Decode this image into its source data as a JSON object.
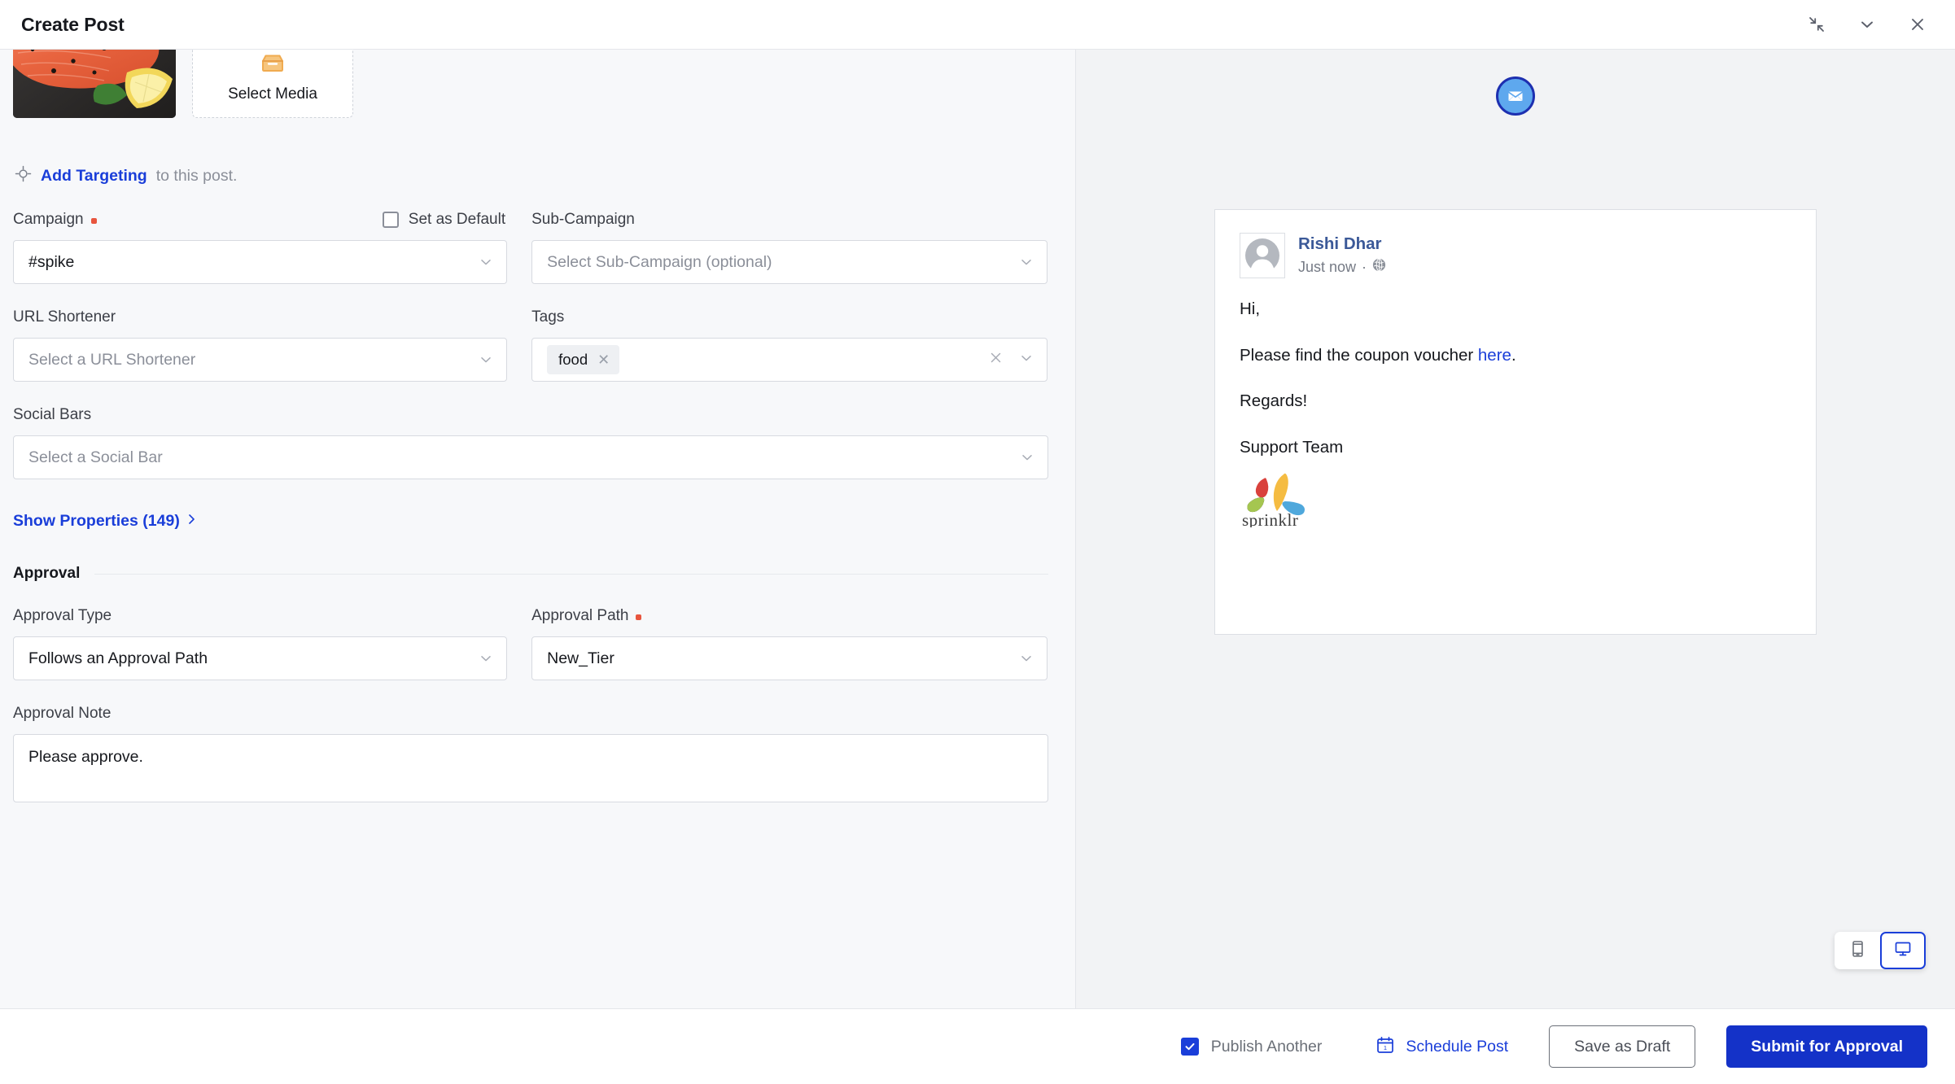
{
  "window": {
    "title": "Create Post",
    "actions": [
      {
        "name": "collapse-icon",
        "label": "Collapse"
      },
      {
        "name": "chevron-down-icon",
        "label": "Minimize"
      },
      {
        "name": "close-icon",
        "label": "Close"
      }
    ]
  },
  "media": {
    "thumbnail_alt": "Raw salmon fillet with rosemary, peppercorns and lemon on slate",
    "select_media_label": "Select Media",
    "select_media_icon": "inbox-icon"
  },
  "targeting": {
    "icon": "target-icon",
    "link_label": "Add Targeting",
    "suffix_text": "to this post."
  },
  "fields": {
    "campaign": {
      "label": "Campaign",
      "required": true,
      "value": "#spike",
      "set_as_default_label": "Set as Default",
      "set_as_default_checked": false
    },
    "sub_campaign": {
      "label": "Sub-Campaign",
      "required": false,
      "placeholder": "Select Sub-Campaign (optional)"
    },
    "url_shortener": {
      "label": "URL Shortener",
      "required": false,
      "placeholder": "Select a URL Shortener"
    },
    "tags": {
      "label": "Tags",
      "required": false,
      "chips": [
        "food"
      ]
    },
    "social_bars": {
      "label": "Social Bars",
      "required": false,
      "placeholder": "Select a Social Bar"
    }
  },
  "show_properties": {
    "label": "Show Properties (149)",
    "chevron": "›"
  },
  "approval": {
    "section_title": "Approval",
    "type": {
      "label": "Approval Type",
      "required": false,
      "value": "Follows an Approval Path"
    },
    "path": {
      "label": "Approval Path",
      "required": true,
      "value": "New_Tier"
    },
    "note": {
      "label": "Approval Note",
      "value": "Please approve."
    }
  },
  "preview": {
    "channel_icon": "email-icon",
    "author_name": "Rishi Dhar",
    "timestamp": "Just now",
    "privacy_icon": "globe-icon",
    "separator": "·",
    "body": {
      "greeting": "Hi,",
      "line_prefix": "Please find the coupon voucher ",
      "link_text": "here",
      "line_suffix": ".",
      "signoff": "Regards!",
      "signature": "Support Team"
    },
    "logo_alt": "sprinklr",
    "logo_wordmark": "sprinklr",
    "device_toggle": {
      "mobile_label": "Mobile preview",
      "desktop_label": "Desktop preview",
      "active": "desktop"
    }
  },
  "footer": {
    "publish_another_label": "Publish Another",
    "publish_another_checked": true,
    "schedule_post_label": "Schedule Post",
    "schedule_icon": "calendar-icon",
    "save_draft_label": "Save as Draft",
    "submit_label": "Submit for Approval"
  },
  "colors": {
    "accent_blue": "#1a3ed9",
    "primary_button": "#1432c8",
    "required_dot": "#e8553e",
    "panel_bg": "#f7f8fa",
    "preview_bg": "#f2f3f5",
    "fb_name_blue": "#3b5998"
  }
}
